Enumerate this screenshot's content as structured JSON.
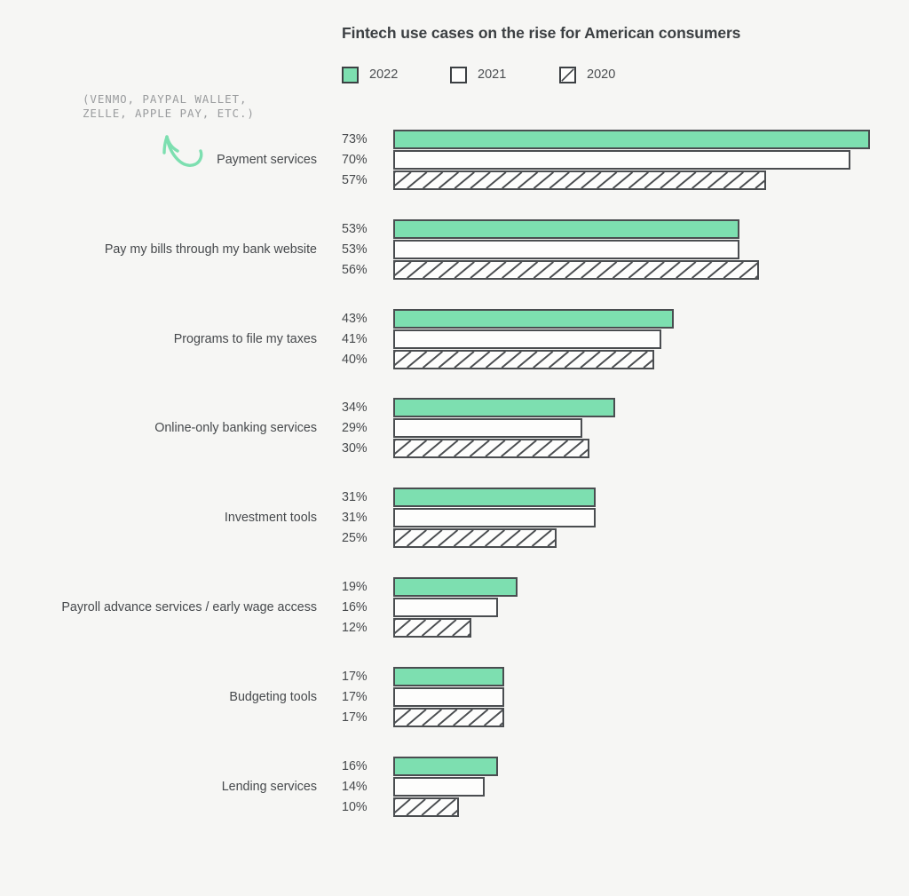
{
  "chart_data": {
    "type": "bar",
    "title": "Fintech use cases on the rise for American consumers",
    "xlabel": "",
    "ylabel": "",
    "xlim": [
      0,
      79
    ],
    "grid": false,
    "orientation": "horizontal",
    "legend_position": "top-left",
    "value_suffix": "%",
    "categories": [
      "Payment services",
      "Pay my bills through my bank website",
      "Programs to file my taxes",
      "Online-only banking services",
      "Investment tools",
      "Payroll advance services / early wage access",
      "Budgeting tools",
      "Lending services"
    ],
    "series": [
      {
        "name": "2022",
        "style": "solid",
        "color": "#7ddfb0",
        "values": [
          73,
          53,
          43,
          34,
          31,
          19,
          17,
          16
        ]
      },
      {
        "name": "2021",
        "style": "outline",
        "color": "#fdfdfc",
        "values": [
          70,
          53,
          41,
          29,
          31,
          16,
          17,
          14
        ]
      },
      {
        "name": "2020",
        "style": "hatch",
        "color": "#fdfdfc",
        "values": [
          57,
          56,
          40,
          30,
          25,
          12,
          17,
          10
        ]
      }
    ],
    "value_labels": [
      [
        "73%",
        "70%",
        "57%"
      ],
      [
        "53%",
        "53%",
        "56%"
      ],
      [
        "43%",
        "41%",
        "40%"
      ],
      [
        "34%",
        "29%",
        "30%"
      ],
      [
        "31%",
        "31%",
        "25%"
      ],
      [
        "19%",
        "16%",
        "12%"
      ],
      [
        "17%",
        "17%",
        "17%"
      ],
      [
        "16%",
        "14%",
        "10%"
      ]
    ],
    "annotation": {
      "text": "(VENMO, PAYPAL WALLET,\nZELLE, APPLE PAY, ETC.)",
      "target": "Payment services",
      "arrow_color": "#7ddfb0"
    }
  },
  "legend": {
    "items": [
      {
        "label": "2022",
        "style": "solid"
      },
      {
        "label": "2021",
        "style": "outline"
      },
      {
        "label": "2020",
        "style": "hatch"
      }
    ]
  },
  "colors": {
    "background": "#f6f6f4",
    "accent": "#7ddfb0",
    "bar_stroke": "#4a4d50",
    "text": "#3c4043",
    "muted_text": "#9a9c9e"
  }
}
